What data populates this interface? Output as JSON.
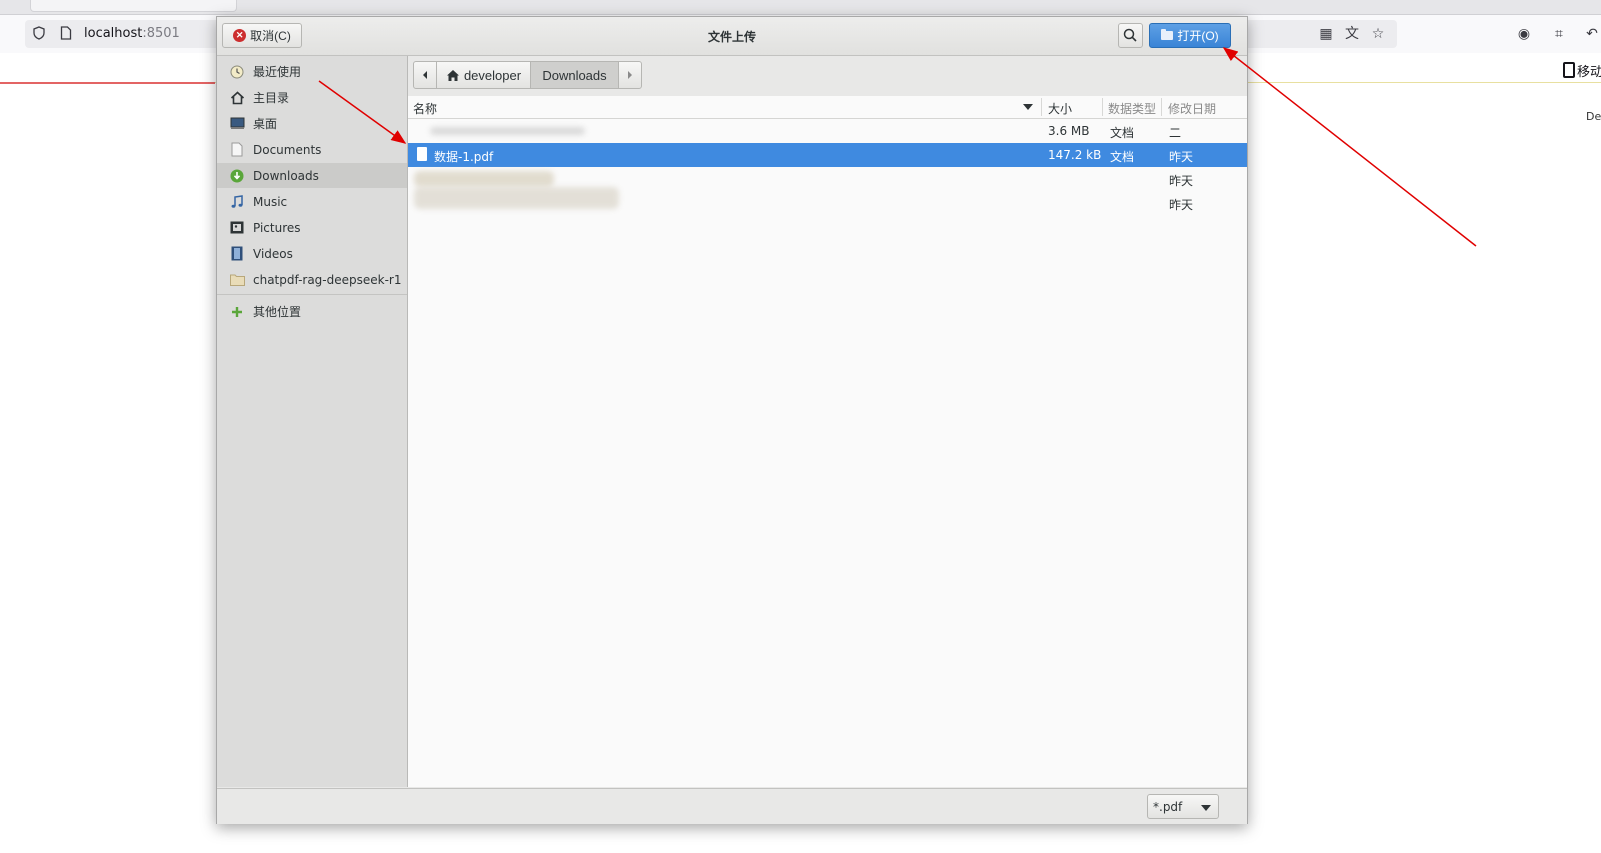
{
  "browser": {
    "url_host": "localhost",
    "url_port": ":8501",
    "mobile_label": "移动",
    "side_text": "De"
  },
  "dialog": {
    "title": "文件上传",
    "cancel_label": "取消(C)",
    "open_label": "打开(O)"
  },
  "sidebar": {
    "items": [
      {
        "label": "最近使用",
        "icon": "recent-icon"
      },
      {
        "label": "主目录",
        "icon": "home-icon"
      },
      {
        "label": "桌面",
        "icon": "desktop-icon"
      },
      {
        "label": "Documents",
        "icon": "documents-icon"
      },
      {
        "label": "Downloads",
        "icon": "downloads-icon"
      },
      {
        "label": "Music",
        "icon": "music-icon"
      },
      {
        "label": "Pictures",
        "icon": "pictures-icon"
      },
      {
        "label": "Videos",
        "icon": "videos-icon"
      },
      {
        "label": "chatpdf-rag-deepseek-r1",
        "icon": "folder-icon"
      }
    ],
    "other_locations": "其他位置",
    "active_item": "Downloads"
  },
  "pathbar": {
    "segments": [
      "developer",
      "Downloads"
    ],
    "current": "Downloads"
  },
  "columns": {
    "name": "名称",
    "size": "大小",
    "type": "数据类型",
    "modified": "修改日期"
  },
  "files": [
    {
      "name": "",
      "size": "3.6 MB",
      "type": "文档",
      "modified": "二"
    },
    {
      "name": "数据-1.pdf",
      "size": "147.2 kB",
      "type": "文档",
      "modified": "昨天",
      "selected": true
    },
    {
      "name": "",
      "size": "",
      "type": "",
      "modified": "昨天"
    },
    {
      "name": "",
      "size": "",
      "type": "",
      "modified": "昨天"
    }
  ],
  "filter": {
    "selected": "*.pdf"
  },
  "colors": {
    "selection": "#3f8ae0",
    "open_button": "#3a84d6",
    "annotation_arrow": "#e00000"
  }
}
